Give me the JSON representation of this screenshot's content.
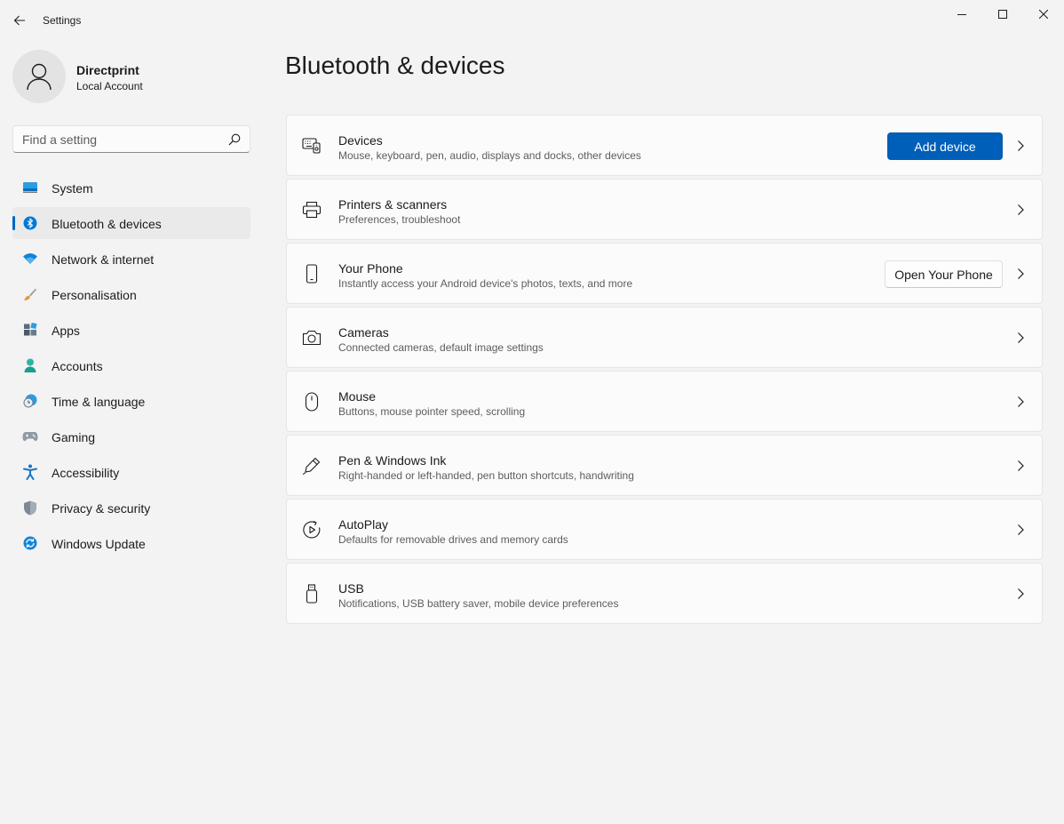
{
  "window": {
    "title": "Settings",
    "icons": {
      "back": "back-arrow-icon",
      "minimize": "minimize-icon",
      "maximize": "maximize-icon",
      "close": "close-icon"
    }
  },
  "profile": {
    "name": "Directprint",
    "account_type": "Local Account",
    "icon": "person-icon"
  },
  "search": {
    "placeholder": "Find a setting",
    "value": "",
    "icon": "search-icon"
  },
  "nav": {
    "selected": "Bluetooth & devices",
    "items": [
      {
        "label": "System",
        "icon": "system-display-icon"
      },
      {
        "label": "Bluetooth & devices",
        "icon": "bluetooth-icon"
      },
      {
        "label": "Network & internet",
        "icon": "wifi-icon"
      },
      {
        "label": "Personalisation",
        "icon": "brush-icon"
      },
      {
        "label": "Apps",
        "icon": "apps-icon"
      },
      {
        "label": "Accounts",
        "icon": "accounts-icon"
      },
      {
        "label": "Time & language",
        "icon": "time-language-icon"
      },
      {
        "label": "Gaming",
        "icon": "gamepad-icon"
      },
      {
        "label": "Accessibility",
        "icon": "accessibility-icon"
      },
      {
        "label": "Privacy & security",
        "icon": "shield-icon"
      },
      {
        "label": "Windows Update",
        "icon": "windows-update-icon"
      }
    ]
  },
  "main": {
    "title": "Bluetooth & devices",
    "cards": [
      {
        "title": "Devices",
        "description": "Mouse, keyboard, pen, audio, displays and docks, other devices",
        "icon": "devices-icon",
        "button": "Add device"
      },
      {
        "title": "Printers & scanners",
        "description": "Preferences, troubleshoot",
        "icon": "printer-icon"
      },
      {
        "title": "Your Phone",
        "description": "Instantly access your Android device's photos, texts, and more",
        "icon": "phone-icon",
        "button": "Open Your Phone"
      },
      {
        "title": "Cameras",
        "description": "Connected cameras, default image settings",
        "icon": "camera-icon"
      },
      {
        "title": "Mouse",
        "description": "Buttons, mouse pointer speed, scrolling",
        "icon": "mouse-icon"
      },
      {
        "title": "Pen & Windows Ink",
        "description": "Right-handed or left-handed, pen button shortcuts, handwriting",
        "icon": "pen-icon"
      },
      {
        "title": "AutoPlay",
        "description": "Defaults for removable drives and memory cards",
        "icon": "autoplay-icon"
      },
      {
        "title": "USB",
        "description": "Notifications, USB battery saver, mobile device preferences",
        "icon": "usb-icon"
      }
    ]
  },
  "colors": {
    "accent": "#005fb8",
    "background": "#f3f3f3",
    "card": "#fbfbfb",
    "nav_selected": "#eaeaea"
  }
}
